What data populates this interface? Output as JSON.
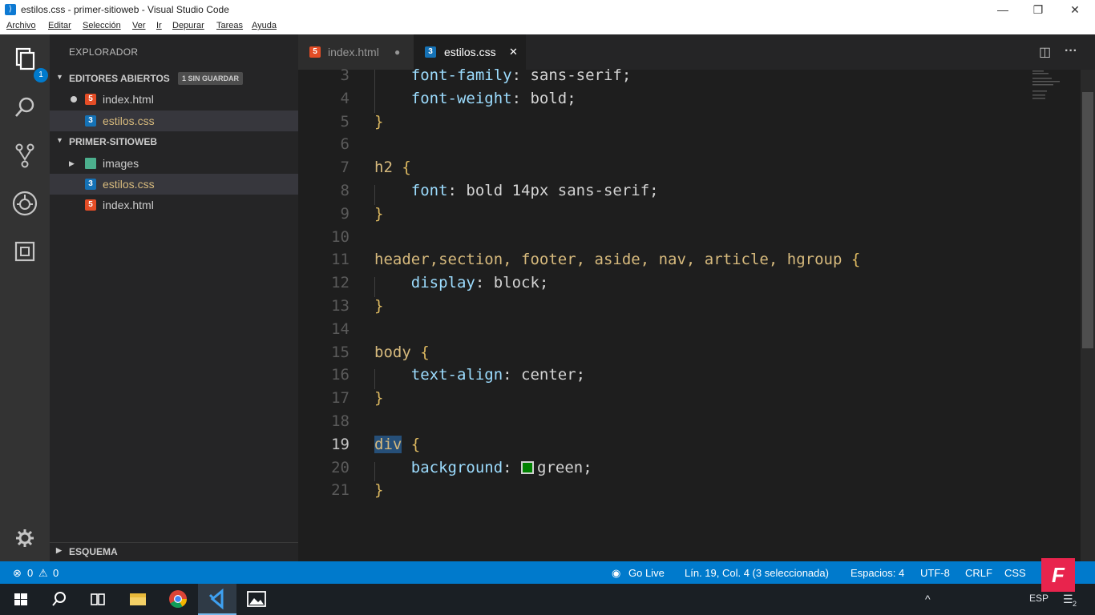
{
  "window": {
    "title": "estilos.css - primer-sitioweb - Visual Studio Code",
    "app_icon": "vscode-icon",
    "minimize": "—",
    "maximize": "❐",
    "close": "✕"
  },
  "menu": [
    "Archivo",
    "Editar",
    "Selección",
    "Ver",
    "Ir",
    "Depurar",
    "Tareas",
    "Ayuda"
  ],
  "activity": {
    "explorer_badge": "1",
    "icons": [
      "explorer-icon",
      "search-icon",
      "source-control-icon",
      "debug-icon",
      "extensions-icon",
      "gear-icon"
    ]
  },
  "sidebar": {
    "title": "EXPLORADOR",
    "open_editors": {
      "label": "EDITORES ABIERTOS",
      "tag": "1 SIN GUARDAR",
      "items": [
        {
          "name": "index.html",
          "type": "html",
          "unsaved": true
        },
        {
          "name": "estilos.css",
          "type": "css",
          "unsaved": false
        }
      ]
    },
    "project": {
      "label": "PRIMER-SITIOWEB",
      "items": [
        {
          "name": "images",
          "type": "folder"
        },
        {
          "name": "estilos.css",
          "type": "css"
        },
        {
          "name": "index.html",
          "type": "html"
        }
      ]
    },
    "outline": "ESQUEMA"
  },
  "tabs": [
    {
      "label": "index.html",
      "type": "html",
      "active": false,
      "unsaved": true
    },
    {
      "label": "estilos.css",
      "type": "css",
      "active": true,
      "unsaved": false
    }
  ],
  "tab_glyphs": {
    "html": "5",
    "css": "3",
    "dirty": "●",
    "close": "✕"
  },
  "editor": {
    "lines": [
      {
        "n": "3",
        "parts": [
          [
            "prop",
            "    font-family"
          ],
          [
            "val",
            ": sans-serif;"
          ]
        ]
      },
      {
        "n": "4",
        "parts": [
          [
            "prop",
            "    font-weight"
          ],
          [
            "val",
            ": bold;"
          ]
        ]
      },
      {
        "n": "5",
        "parts": [
          [
            "brace",
            "}"
          ]
        ]
      },
      {
        "n": "6",
        "parts": []
      },
      {
        "n": "7",
        "parts": [
          [
            "sel",
            "h2 "
          ],
          [
            "brace",
            "{"
          ]
        ]
      },
      {
        "n": "8",
        "parts": [
          [
            "prop",
            "    font"
          ],
          [
            "val",
            ": bold 14px sans-serif;"
          ]
        ]
      },
      {
        "n": "9",
        "parts": [
          [
            "brace",
            "}"
          ]
        ]
      },
      {
        "n": "10",
        "parts": []
      },
      {
        "n": "11",
        "parts": [
          [
            "sel",
            "header,section, footer, aside, nav, article, hgroup "
          ],
          [
            "brace",
            "{"
          ]
        ]
      },
      {
        "n": "12",
        "parts": [
          [
            "prop",
            "    display"
          ],
          [
            "val",
            ": block;"
          ]
        ]
      },
      {
        "n": "13",
        "parts": [
          [
            "brace",
            "}"
          ]
        ]
      },
      {
        "n": "14",
        "parts": []
      },
      {
        "n": "15",
        "parts": [
          [
            "sel",
            "body "
          ],
          [
            "brace",
            "{"
          ]
        ]
      },
      {
        "n": "16",
        "parts": [
          [
            "prop",
            "    text-align"
          ],
          [
            "val",
            ": center;"
          ]
        ]
      },
      {
        "n": "17",
        "parts": [
          [
            "brace",
            "}"
          ]
        ]
      },
      {
        "n": "18",
        "parts": []
      },
      {
        "n": "19",
        "parts": [
          [
            "selhl",
            "div"
          ],
          [
            "sel",
            " "
          ],
          [
            "brace",
            "{"
          ]
        ]
      },
      {
        "n": "20",
        "parts": [
          [
            "prop",
            "    background"
          ],
          [
            "val",
            ": "
          ],
          [
            "swatch",
            ""
          ],
          [
            "val",
            "green;"
          ]
        ]
      },
      {
        "n": "21",
        "parts": [
          [
            "brace",
            "}"
          ]
        ]
      }
    ],
    "active_line": "19",
    "swatch_color": "#008000"
  },
  "status": {
    "errors": "0",
    "warnings": "0",
    "go_live": "Go Live",
    "position": "Lín. 19, Col. 4 (3 seleccionada)",
    "spaces": "Espacios: 4",
    "encoding": "UTF-8",
    "eol": "CRLF",
    "language": "CSS",
    "error_glyph": "⊗",
    "warning_glyph": "⚠",
    "live_glyph": "◉"
  },
  "taskbar": {
    "apps": [
      "start-icon",
      "search-icon",
      "task-view-icon",
      "file-explorer-icon",
      "chrome-icon",
      "vscode-icon",
      "photos-icon"
    ],
    "tray": {
      "lang": "ESP",
      "notif": "2",
      "caret": "^",
      "bell": "☰"
    }
  },
  "watermark": "F",
  "colors": {
    "accent": "#007acc",
    "selector": "#d7ba7d",
    "property": "#9cdcfe",
    "brace": "#dcb860"
  }
}
